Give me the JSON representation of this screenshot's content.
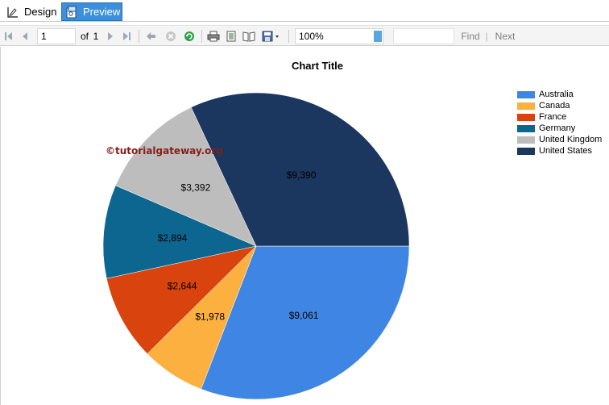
{
  "tabs": {
    "design_label": "Design",
    "preview_label": "Preview"
  },
  "toolbar": {
    "page_current": "1",
    "page_of": "of",
    "page_total": "1",
    "zoom_value": "100%",
    "find_label": "Find",
    "separator": "|",
    "next_label": "Next"
  },
  "watermark": "©tutorialgateway.org",
  "chart_data": {
    "type": "pie",
    "title": "Chart Title",
    "legend_position": "top-right",
    "slices": [
      {
        "label": "Australia",
        "value": 9061,
        "display": "$9,061",
        "color": "#3f86e4"
      },
      {
        "label": "Canada",
        "value": 1978,
        "display": "$1,978",
        "color": "#fbb040"
      },
      {
        "label": "France",
        "value": 2644,
        "display": "$2,644",
        "color": "#d9430d"
      },
      {
        "label": "Germany",
        "value": 2894,
        "display": "$2,894",
        "color": "#0d6690"
      },
      {
        "label": "United Kingdom",
        "value": 3392,
        "display": "$3,392",
        "color": "#bdbdbd"
      },
      {
        "label": "United States",
        "value": 9390,
        "display": "$9,390",
        "color": "#1b365f"
      }
    ]
  }
}
